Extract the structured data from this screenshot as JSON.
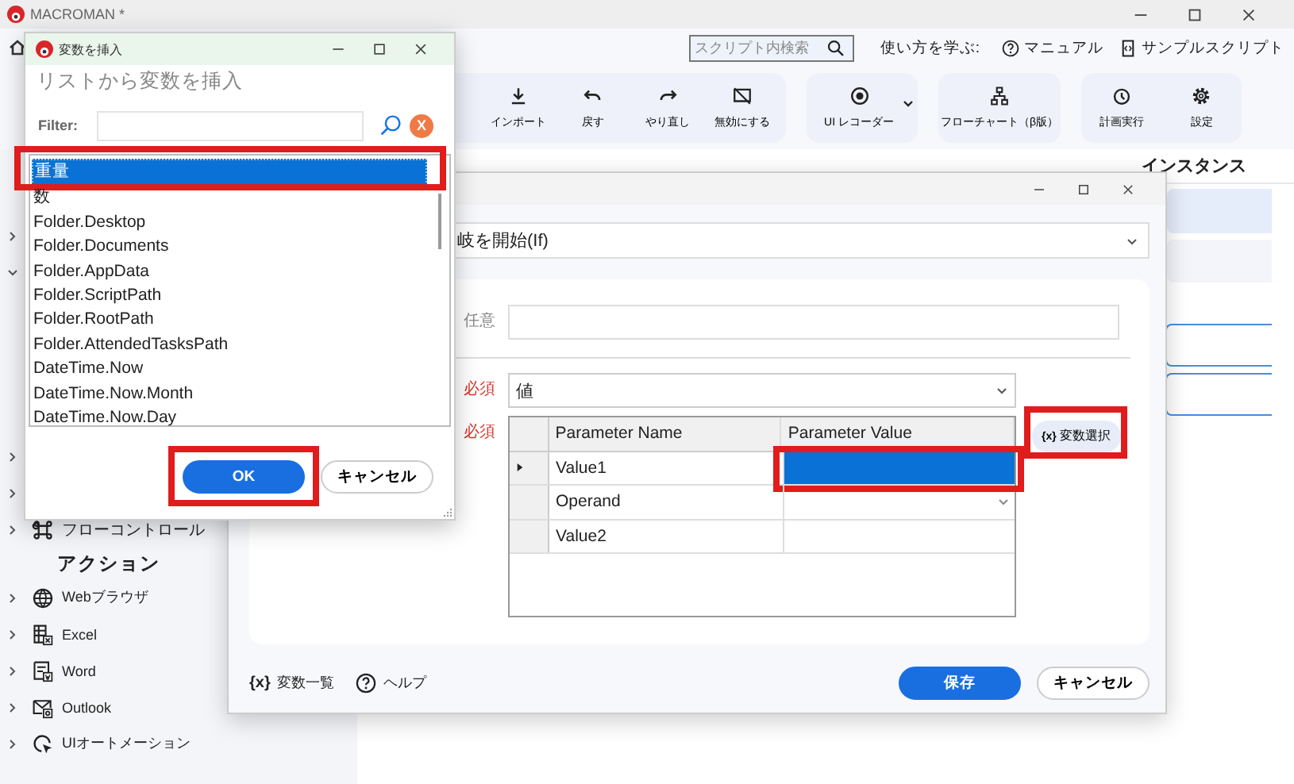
{
  "app": {
    "title": "MACROMAN *",
    "search_placeholder": "スクリプト内検索",
    "learn_label": "使い方を学ぶ:",
    "links": [
      {
        "label": "マニュアル",
        "kind": "help"
      },
      {
        "label": "サンプルスクリプト",
        "kind": "sample"
      }
    ]
  },
  "toolbar_groups": [
    [
      {
        "label": "インポート",
        "kind": "import"
      },
      {
        "label": "戻す",
        "kind": "undo"
      },
      {
        "label": "やり直し",
        "kind": "redo"
      },
      {
        "label": "無効にする",
        "kind": "disable"
      }
    ],
    [
      {
        "label": "UI レコーダー",
        "kind": "recorder",
        "dropdown": true
      }
    ],
    [
      {
        "label": "フローチャート（β版）",
        "kind": "flowchart"
      }
    ],
    [
      {
        "label": "計画実行",
        "kind": "schedule"
      },
      {
        "label": "設定",
        "kind": "settings"
      }
    ]
  ],
  "column_header": "インスタンス",
  "sidebar": {
    "upper_toggles": [
      {
        "expanded": false
      },
      {
        "expanded": true
      }
    ],
    "lower_toggles": [
      {
        "expanded": false
      },
      {
        "expanded": false
      }
    ],
    "control_items": [
      {
        "label": "フローコントロール",
        "kind": "command"
      }
    ],
    "section_title": "アクション",
    "action_items": [
      {
        "label": "Webブラウザ",
        "kind": "globe"
      },
      {
        "label": "Excel",
        "kind": "sheet"
      },
      {
        "label": "Word",
        "kind": "doc"
      },
      {
        "label": "Outlook",
        "kind": "mail"
      },
      {
        "label": "UIオートメーション",
        "kind": "cursor"
      }
    ]
  },
  "condition_dialog": {
    "action_select": "岐を開始(If)",
    "optional_label": "任意",
    "value_type_label": "必須",
    "value_type": "値",
    "params_label": "必須",
    "grid": {
      "columns": [
        "Parameter Name",
        "Parameter Value"
      ],
      "rows": [
        {
          "name": "Value1",
          "selected": true,
          "kind": "text",
          "highlighted": true
        },
        {
          "name": "Operand",
          "selected": false,
          "kind": "dropdown",
          "highlighted": false
        },
        {
          "name": "Value2",
          "selected": false,
          "kind": "text",
          "highlighted": false
        }
      ]
    },
    "variable_button": {
      "icon": "{x}",
      "label": "変数選択",
      "highlighted": true
    },
    "footer_links": [
      {
        "icon": "{x}",
        "label": "変数一覧",
        "kind": "variables"
      },
      {
        "label": "ヘルプ",
        "kind": "help"
      }
    ],
    "buttons": [
      {
        "label": "保存",
        "primary": true
      },
      {
        "label": "キャンセル",
        "primary": false
      }
    ]
  },
  "insert_dialog": {
    "title": "変数を挿入",
    "heading": "リストから変数を挿入",
    "filter_label": "Filter:",
    "clear_label": "X",
    "items": [
      {
        "label": "重量",
        "selected": true,
        "highlighted": true
      },
      {
        "label": "数",
        "selected": false,
        "highlighted": false
      },
      {
        "label": "Folder.Desktop",
        "selected": false,
        "highlighted": false
      },
      {
        "label": "Folder.Documents",
        "selected": false,
        "highlighted": false
      },
      {
        "label": "Folder.AppData",
        "selected": false,
        "highlighted": false
      },
      {
        "label": "Folder.ScriptPath",
        "selected": false,
        "highlighted": false
      },
      {
        "label": "Folder.RootPath",
        "selected": false,
        "highlighted": false
      },
      {
        "label": "Folder.AttendedTasksPath",
        "selected": false,
        "highlighted": false
      },
      {
        "label": "DateTime.Now",
        "selected": false,
        "highlighted": false
      },
      {
        "label": "DateTime.Now.Month",
        "selected": false,
        "highlighted": false
      },
      {
        "label": "DateTime.Now.Day",
        "selected": false,
        "highlighted": false
      }
    ],
    "buttons": [
      {
        "label": "OK",
        "primary": true,
        "highlighted": true
      },
      {
        "label": "キャンセル",
        "primary": false,
        "highlighted": false
      }
    ]
  }
}
